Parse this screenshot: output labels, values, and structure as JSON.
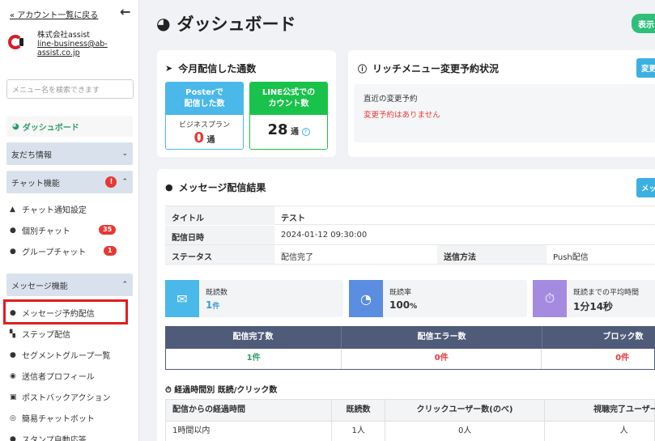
{
  "sidebar": {
    "back_link": "« アカウント一覧に戻る",
    "account_name": "株式会社assist",
    "account_email_1": "line-business@ab-",
    "account_email_2": "assist.co.jp",
    "search_placeholder": "メニュー名を検索できます",
    "dashboard_label": "ダッシュボード",
    "groups": [
      {
        "label": "友だち情報",
        "expanded": false
      },
      {
        "label": "チャット機能",
        "expanded": true,
        "warning": "!"
      },
      {
        "label": "メッセージ機能",
        "expanded": true
      }
    ],
    "chat_items": [
      {
        "label": "チャット通知設定"
      },
      {
        "label": "個別チャット",
        "badge": "35"
      },
      {
        "label": "グループチャット",
        "badge": "1"
      }
    ],
    "message_items": [
      {
        "label": "メッセージ予約配信",
        "highlighted": true
      },
      {
        "label": "ステップ配信"
      },
      {
        "label": "セグメントグループ一覧"
      },
      {
        "label": "送信者プロフィール"
      },
      {
        "label": "ポストバックアクション"
      },
      {
        "label": "簡易チャットボット"
      },
      {
        "label": "スタンプ自動応答"
      }
    ]
  },
  "header": {
    "title": "ダッシュボード",
    "top_button": "表示"
  },
  "monthly": {
    "title": "今月配信した通数",
    "poster_head_1": "Posterで",
    "poster_head_2": "配信した数",
    "poster_sub": "ビジネスプラン",
    "poster_value": "0",
    "poster_unit": "通",
    "line_head_1": "LINE公式での",
    "line_head_2": "カウント数",
    "line_value": "28",
    "line_unit": "通",
    "help_icon": "?"
  },
  "rich_menu": {
    "title": "リッチメニュー変更予約状況",
    "button": "変更",
    "recent_label": "直近の変更予約",
    "none_text": "変更予約はありません"
  },
  "message_result": {
    "title": "メッセージ配信結果",
    "button": "メッ",
    "rows": {
      "title_label": "タイトル",
      "title_value": "テスト",
      "date_label": "配信日時",
      "date_value": "2024-01-12 09:30:00",
      "status_label": "ステータス",
      "status_value": "配信完了",
      "method_label": "送信方法",
      "method_value": "Push配信"
    },
    "kpis": [
      {
        "label": "既読数",
        "value": "1",
        "unit": "件"
      },
      {
        "label": "既読率",
        "value": "100",
        "unit": "%"
      },
      {
        "label": "既読までの平均時間",
        "value": "1分14秒",
        "unit": ""
      }
    ],
    "result_headers": [
      "配信完了数",
      "配信エラー数",
      "ブロック数"
    ],
    "result_values": [
      "1件",
      "0件",
      "0件"
    ],
    "elapsed_title": "経過時間別 既読/クリック数",
    "elapsed_headers": [
      "配信からの経過時間",
      "既読数",
      "クリックユーザー数(のべ)",
      "視聴完了ユーザー数"
    ],
    "elapsed_rows": [
      [
        "1時間以内",
        "1人",
        "0人",
        "人"
      ]
    ]
  },
  "colors": {
    "accent_green": "#2fbf7a",
    "poster_blue": "#4ab8e8",
    "line_green": "#19c24a",
    "alert_red": "#e53935",
    "table_header": "#4f5b78"
  }
}
